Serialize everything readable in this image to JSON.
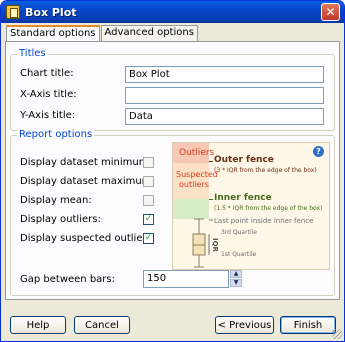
{
  "window": {
    "title": "Box Plot"
  },
  "tabs": [
    {
      "label": "Standard options",
      "active": true
    },
    {
      "label": "Advanced options",
      "active": false
    }
  ],
  "titles_group": {
    "label": "Titles",
    "chart_title_label": "Chart title:",
    "chart_title_value": "Box Plot",
    "xaxis_title_label": "X-Axis title:",
    "xaxis_title_value": "",
    "yaxis_title_label": "Y-Axis title:",
    "yaxis_title_value": "Data"
  },
  "report_group": {
    "label": "Report options",
    "options": [
      {
        "label": "Display dataset minimum:",
        "checked": false
      },
      {
        "label": "Display dataset maximum:",
        "checked": false
      },
      {
        "label": "Display mean:",
        "checked": false
      },
      {
        "label": "Display outliers:",
        "checked": true
      },
      {
        "label": "Display suspected outliers.",
        "checked": true
      }
    ],
    "check_mark": "✓"
  },
  "figure": {
    "outliers": "Outliers",
    "suspected": "Suspected",
    "suspected2": "outliers",
    "outer_fence": "Outer fence",
    "outer_fence_note": "(3 * IQR from the edge of the box)",
    "inner_fence": "Inner fence",
    "inner_fence_note": "(1.5 * IQR from the edge of the box)",
    "last_point": "Last point inside inner fence",
    "q3": "3rd Quartile",
    "q1": "1st Quartile",
    "iqr": "IQR",
    "help_icon_glyph": "?"
  },
  "gap": {
    "label": "Gap between bars:",
    "value": "150"
  },
  "buttons": {
    "help": "Help",
    "cancel": "Cancel",
    "previous": "< Previous",
    "finish": "Finish"
  },
  "colors": {
    "outer_band": "#f7c8b4",
    "suspect_band": "#fbe2c7",
    "inner_band": "#d7ecc8",
    "outer_text": "#6b2d12",
    "inner_text": "#4a6a1e",
    "gray_text": "#6e6e6e",
    "outliers_red": "#d33b1f"
  }
}
